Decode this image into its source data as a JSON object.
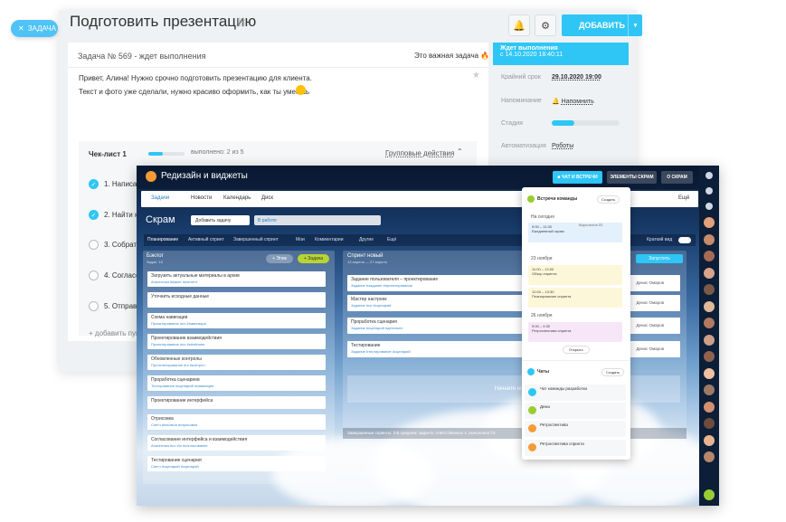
{
  "task_tab": {
    "label": "ЗАДАЧА"
  },
  "task": {
    "title": "Подготовить презентацию",
    "add_button": "ДОБАВИТЬ",
    "number": "Задача № 569 - ждет выполнения",
    "important": "Это важная задача",
    "message_line1": "Привет, Алина! Нужно срочно подготовить презентацию для клиента.",
    "message_line2": "Текст и фото уже сделали, нужно красиво оформить, как ты умеешь",
    "checklist_title": "Чек-лист 1",
    "checklist_done": "выполнено: 2 из 5",
    "checklist_progress": 0.4,
    "group_actions": "Групповые действия",
    "items": [
      "1. Написать",
      "2. Найти ка",
      "3. Собрать",
      "4. Согласо",
      "5. Отправ"
    ],
    "add_more": "+ добавить пункт"
  },
  "status": {
    "title": "Ждет выполнения",
    "since": "с 14.10.2020 18:40:11",
    "deadline_label": "Крайний срок",
    "deadline_value": "29.10.2020 19:00",
    "reminder_label": "Напоминание",
    "reminder_value": "Напомнить",
    "stage_label": "Стадия",
    "stage_progress": 0.33,
    "automation_label": "Автоматизация",
    "automation_value": "Роботы"
  },
  "front": {
    "title": "Редизайн и виджеты",
    "btn_video": "ЧАТ И ВСТРЕЧИ",
    "btn_elements": "ЭЛЕМЕНТЫ СКРАМ",
    "btn_scrum": "О СКРАМ",
    "tabs": [
      "Задачи",
      "Новости",
      "Календарь",
      "Диск"
    ],
    "tab_more": "Ещё",
    "board": "Скрам",
    "add_task": "Добавить задачу",
    "filter": "В работе",
    "sprint_tabs": [
      "Планирование",
      "Активный спринт",
      "Завершенный спринт",
      "Мои",
      "Комментарии",
      "Другие",
      "Ещё"
    ],
    "compact": "Краткий вид",
    "backlog_title": "Бэклог",
    "backlog_sub": "Задач: 15",
    "epic": "+ Эпик",
    "add_task_btn": "+ Задача",
    "backlog_cards": [
      {
        "n": "Загрузить актуальные материалы в архив",
        "m": "Аналитика  #макет  #контент"
      },
      {
        "n": "Уточнить исходные данные",
        "m": ""
      },
      {
        "n": "Схема навигации",
        "m": "Проектирование  #ux  #навигация"
      },
      {
        "n": "Проектирование взаимодействия",
        "m": "Проектирование  #ux  #wireframe"
      },
      {
        "n": "Обновленные контролы",
        "m": "Прототипирование  #ui  #контрол"
      },
      {
        "n": "Проработка сценариев",
        "m": "Тестирование  #сценарий  #навигация"
      },
      {
        "n": "Проектирование интерфейса",
        "m": ""
      },
      {
        "n": "Отрисовка",
        "m": "Скетч  #наствоя  #отрисовка"
      },
      {
        "n": "Согласование интерфейса и взаимодействия",
        "m": "Аналитика  #ux  #ui  #согласование"
      },
      {
        "n": "Тестирование сценария",
        "m": "Скетч  #сценарий  #сценарий"
      }
    ],
    "sprint_title": "Спринт новый",
    "sprint_sub": "13 апреля — 27 апреля",
    "start_sprint": "Запустить",
    "sprint_cards": [
      {
        "n": "Задание пользователя – проектирование",
        "m": "Задание  #задание  #проектирование"
      },
      {
        "n": "Мастер настроек",
        "m": "Задание  #ux  #сценарий"
      },
      {
        "n": "Проработка сценария",
        "m": "Задание  #сценарий  #детально"
      },
      {
        "n": "Тестирование",
        "m": "Задание  #тестирование  #сценарий"
      }
    ],
    "assignee": "Денис Омаров",
    "sprint_drop": "Начните новый",
    "done_row": "Завершенные спринты: 3    В среднем: задач 9, ответственных 4, выполнено 73"
  },
  "popup": {
    "header": "Встречи команды",
    "create": "Создать",
    "today": "На сегодня",
    "events_today": [
      {
        "t": "9:00 – 11:30",
        "n": "Ежедневный скрам",
        "s": "Видеозвонок ЕЕ"
      }
    ],
    "date1": "23 ноября",
    "events1": [
      {
        "t": "11:00 – 13:00",
        "n": "Обзор спринта"
      },
      {
        "t": "12:00 – 13:30",
        "n": "Планирование спринта"
      }
    ],
    "date2": "26 ноября",
    "events2": [
      {
        "t": "9:00 – 9:30",
        "n": "Ретроспектива спринта"
      }
    ],
    "open": "Открыть",
    "chats_header": "Чаты",
    "chats_create": "Создать",
    "chats": [
      "Чат команды разработки",
      "Демо",
      "Ретроспектива",
      "Ретроспектива спринта"
    ]
  },
  "colors": {
    "accent": "#2fc6f6",
    "lime": "#b8d432",
    "rail": "#0c1e38"
  }
}
